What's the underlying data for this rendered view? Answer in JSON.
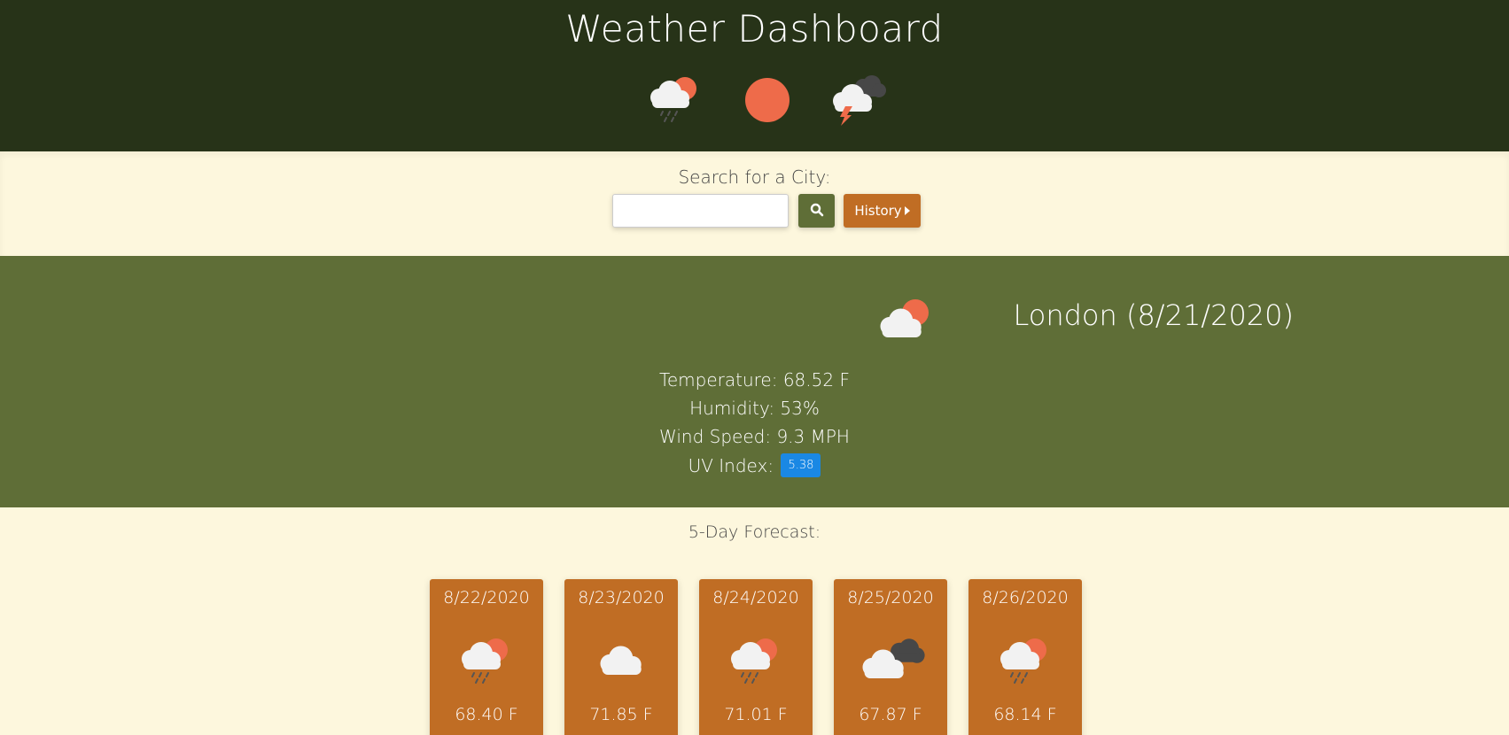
{
  "header": {
    "title": "Weather Dashboard",
    "icons": [
      "rain-sun-icon",
      "sun-icon",
      "thunderstorm-icon"
    ]
  },
  "search": {
    "label": "Search for a City:",
    "input_value": "",
    "placeholder": "",
    "search_icon": "search-icon",
    "history_label": "History"
  },
  "current": {
    "title": "London (8/21/2020)",
    "icon": "partly-cloudy-icon",
    "temperature": "Temperature: 68.52 F",
    "humidity": "Humidity: 53%",
    "wind": "Wind Speed: 9.3 MPH",
    "uv_label": "UV Index:",
    "uv_value": "5.38"
  },
  "forecast": {
    "label": "5-Day Forecast:",
    "days": [
      {
        "date": "8/22/2020",
        "icon": "rain-sun-icon",
        "temp": "68.40 F"
      },
      {
        "date": "8/23/2020",
        "icon": "cloud-icon",
        "temp": "71.85 F"
      },
      {
        "date": "8/24/2020",
        "icon": "rain-sun-icon",
        "temp": "71.01 F"
      },
      {
        "date": "8/25/2020",
        "icon": "overcast-icon",
        "temp": "67.87 F"
      },
      {
        "date": "8/26/2020",
        "icon": "rain-sun-icon",
        "temp": "68.14 F"
      }
    ]
  },
  "colors": {
    "header_bg": "#273318",
    "page_bg": "#fdf7dd",
    "current_bg": "#5f6e37",
    "card_bg": "#c06d24",
    "sun": "#ee6b4a",
    "uv_badge": "#1a88e4"
  }
}
